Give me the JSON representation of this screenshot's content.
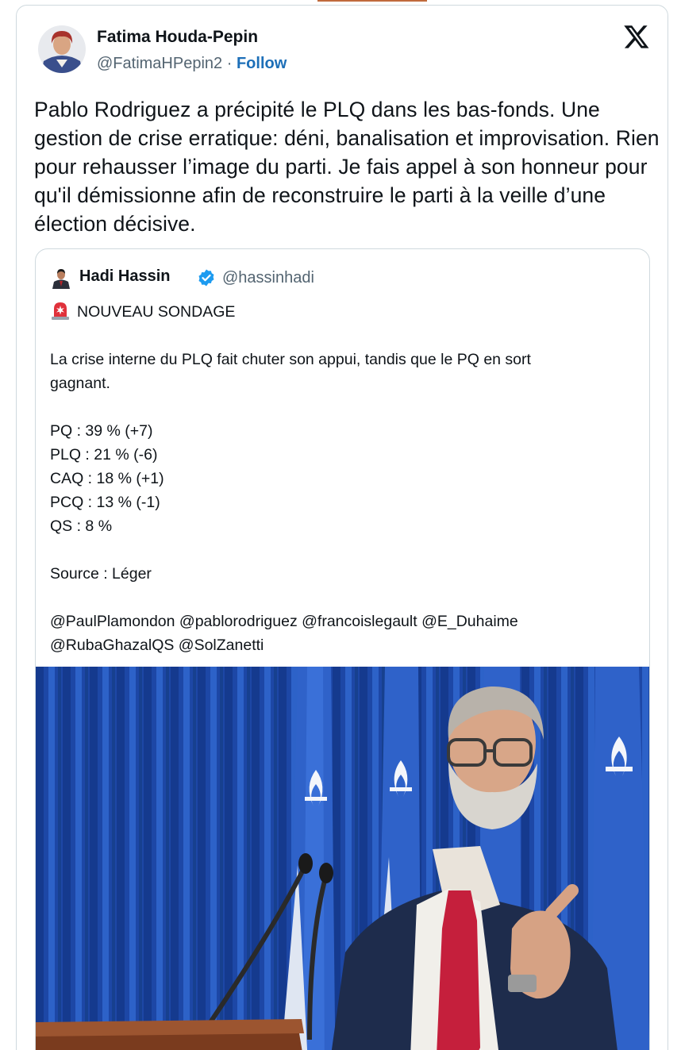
{
  "author": {
    "name": "Fatima Houda-Pepin",
    "handle": "@FatimaHPepin2",
    "separator": "·",
    "follow_label": "Follow"
  },
  "tweet_text": "Pablo Rodriguez a précipité le PLQ dans les bas-fonds. Une gestion de crise erratique: déni, banalisation et improvisation. Rien pour rehausser l’image du parti. Je fais appel à son honneur pour qu'il démissionne afin de reconstruire le parti à la veille d’une élection décisive.",
  "quoted_tweet": {
    "name": "Hadi Hassin",
    "handle": "@hassinhadi",
    "headline": "NOUVEAU SONDAGE",
    "intro_line1": "La crise interne du PLQ fait chuter son appui, tandis que le PQ en sort",
    "intro_line2": "gagnant.",
    "poll": [
      {
        "text": "PQ : 39 %  (+7)"
      },
      {
        "text": "PLQ : 21 %  (-6)"
      },
      {
        "text": "CAQ : 18 %  (+1)"
      },
      {
        "text": "PCQ : 13 %  (-1)"
      },
      {
        "text": "QS : 8 %"
      }
    ],
    "source": "Source : Léger",
    "mentions_line1": "@PaulPlamondon @pablorodriguez @francoislegault @E_Duhaime",
    "mentions_line2": "@RubaGhazalQS @SolZanetti"
  },
  "icons": {
    "x_logo": "x-logo-icon",
    "verified": "verified-badge-icon",
    "siren": "rotating-light-icon"
  },
  "colors": {
    "follow": "#1d6fb8",
    "verified": "#1d9bf0",
    "border": "#cfd9de",
    "secondary_text": "#536471"
  }
}
